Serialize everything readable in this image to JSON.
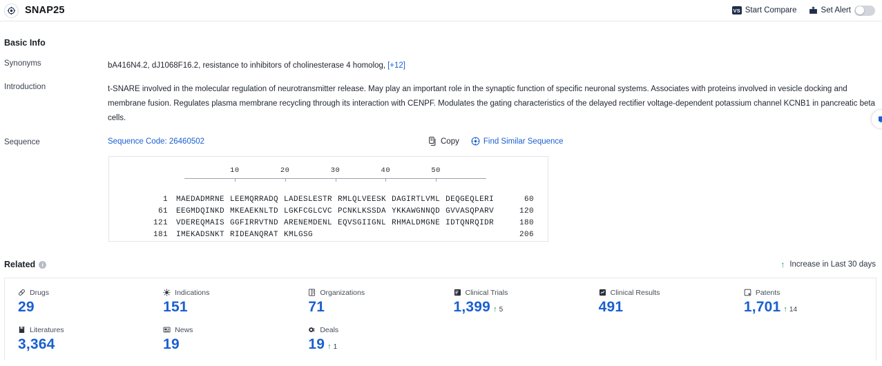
{
  "topbar": {
    "title": "SNAP25",
    "logo_icon": "target-crosshair-icon",
    "start_compare_label": "Start Compare",
    "compare_badge": "VS",
    "set_alert_label": "Set Alert",
    "alert_toggle_state": "off"
  },
  "basic_info": {
    "heading": "Basic Info",
    "synonyms_label": "Synonyms",
    "synonyms_value": "bA416N4.2,  dJ1068F16.2,  resistance to inhibitors of cholinesterase 4 homolog,",
    "synonyms_more": "[+12]",
    "introduction_label": "Introduction",
    "introduction_value": "t-SNARE involved in the molecular regulation of neurotransmitter release. May play an important role in the synaptic function of specific neuronal systems. Associates with proteins involved in vesicle docking and membrane fusion. Regulates plasma membrane recycling through its interaction with CENPF. Modulates the gating characteristics of the delayed rectifier voltage-dependent potassium channel KCNB1 in pancreatic beta cells."
  },
  "sequence": {
    "label": "Sequence",
    "code_text": "Sequence Code: 26460502",
    "copy_label": "Copy",
    "copy_icon": "copy-icon",
    "find_similar_label": "Find Similar Sequence",
    "find_similar_icon": "find-similar-icon",
    "ruler_ticks": [
      "10",
      "20",
      "30",
      "40",
      "50"
    ],
    "rows": [
      {
        "start": "1",
        "chunks": [
          "MAEDADMRNE",
          "LEEMQRRADQ",
          "LADESLESTR",
          "RMLQLVEESK",
          "DAGIRTLVML",
          "DEQGEQLERI"
        ],
        "end": "60"
      },
      {
        "start": "61",
        "chunks": [
          "EEGMDQINKD",
          "MKEAEKNLTD",
          "LGKFCGLCVC",
          "PCNKLKSSDA",
          "YKKAWGNNQD",
          "GVVASQPARV"
        ],
        "end": "120"
      },
      {
        "start": "121",
        "chunks": [
          "VDEREQMAIS",
          "GGFIRRVTND",
          "ARENEMDENL",
          "EQVSGIIGNL",
          "RHMALDMGNE",
          "IDTQNRQIDR"
        ],
        "end": "180"
      },
      {
        "start": "181",
        "chunks": [
          "IMEKADSNKT",
          "RIDEANQRAT",
          "KMLGSG"
        ],
        "end": "206"
      }
    ]
  },
  "related": {
    "heading": "Related",
    "info_icon_char": "i",
    "increase_note": "Increase in Last 30 days",
    "increase_arrow": "↑",
    "accent_link_color": "#1a5fd0",
    "increase_color": "#16933f",
    "stats": [
      {
        "label": "Drugs",
        "icon": "pill-icon",
        "value": "29",
        "delta": ""
      },
      {
        "label": "Indications",
        "icon": "virus-icon",
        "value": "151",
        "delta": ""
      },
      {
        "label": "Organizations",
        "icon": "building-icon",
        "value": "71",
        "delta": ""
      },
      {
        "label": "Clinical Trials",
        "icon": "clinical-trial-icon",
        "value": "1,399",
        "delta": "5"
      },
      {
        "label": "Clinical Results",
        "icon": "clinical-result-icon",
        "value": "491",
        "delta": ""
      },
      {
        "label": "Patents",
        "icon": "patent-icon",
        "value": "1,701",
        "delta": "14"
      },
      {
        "label": "Literatures",
        "icon": "literature-icon",
        "value": "3,364",
        "delta": ""
      },
      {
        "label": "News",
        "icon": "news-icon",
        "value": "19",
        "delta": ""
      },
      {
        "label": "Deals",
        "icon": "deals-icon",
        "value": "19",
        "delta": "1"
      }
    ]
  },
  "side_fab": {
    "icon": "chat-bubble-icon"
  }
}
